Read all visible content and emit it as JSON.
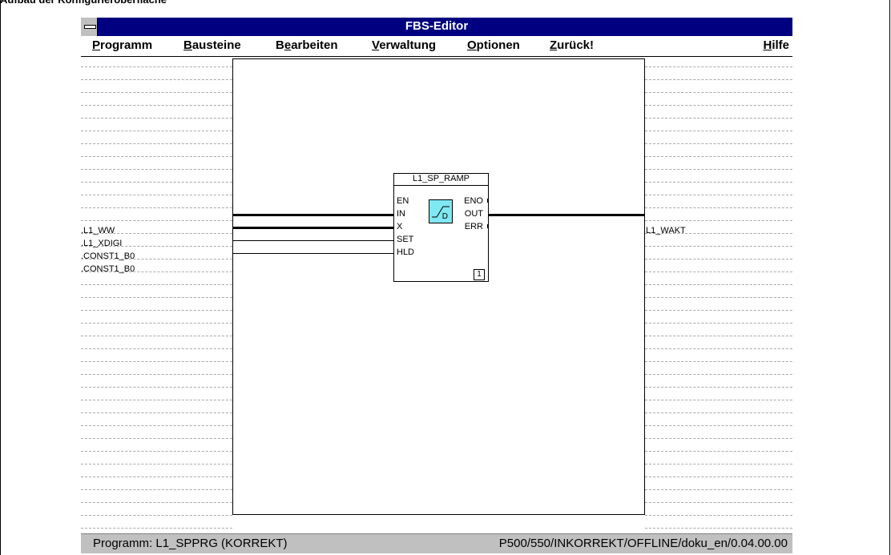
{
  "doc_heading": "Aufbau der Konfigurieroberfläche",
  "window": {
    "title": "FBS-Editor"
  },
  "menu": {
    "items": [
      {
        "pre": "",
        "accel": "P",
        "post": "rogramm"
      },
      {
        "pre": "",
        "accel": "B",
        "post": "austeine"
      },
      {
        "pre": "B",
        "accel": "e",
        "post": "arbeiten"
      },
      {
        "pre": "",
        "accel": "V",
        "post": "erwaltung"
      },
      {
        "pre": "",
        "accel": "O",
        "post": "ptionen"
      },
      {
        "pre": "",
        "accel": "Z",
        "post": "urück!"
      }
    ],
    "help": {
      "pre": "",
      "accel": "H",
      "post": "ilfe"
    }
  },
  "signals": {
    "inputs": [
      ".L1_WW",
      ".L1_XDIGI",
      ".CONST1_B0",
      ".CONST1_B0"
    ],
    "output": ".L1_WAKT"
  },
  "function_block": {
    "name": "L1_SP_RAMP",
    "inputs": [
      "EN",
      "IN",
      "X",
      "SET",
      "HLD"
    ],
    "outputs": [
      "ENO",
      "OUT",
      "ERR"
    ],
    "symbol_letter": "D",
    "index": "1"
  },
  "status": {
    "left": "Programm: L1_SPPRG (KORREKT)",
    "right": "P500/550/INKORREKT/OFFLINE/doku_en/0.04.00.00"
  },
  "colors": {
    "titlebar": "#000080",
    "statusbar": "#c0c0c0",
    "ramp_icon": "#7fe8f2"
  }
}
